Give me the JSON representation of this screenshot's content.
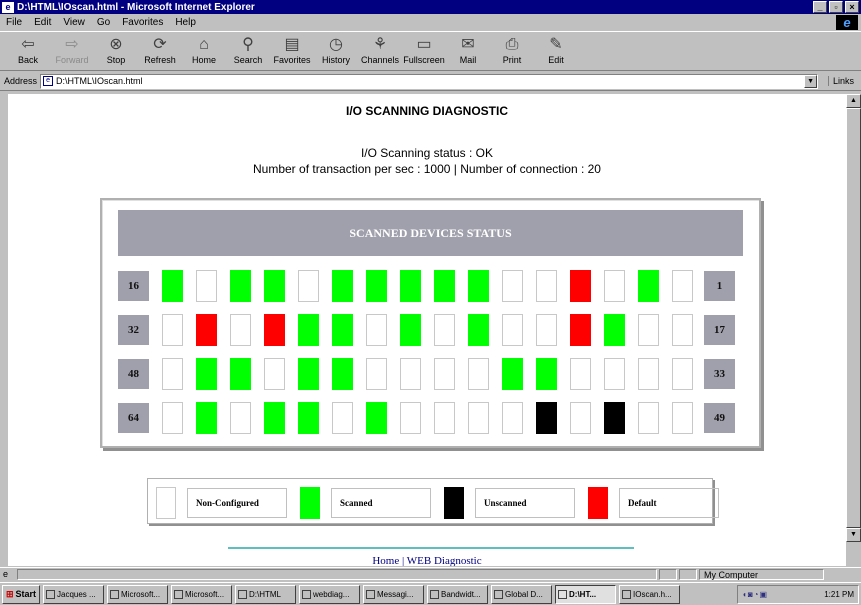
{
  "window": {
    "title": "D:\\HTML\\IOscan.html - Microsoft Internet Explorer",
    "controls": [
      "_",
      "▫",
      "×"
    ]
  },
  "menu": [
    "File",
    "Edit",
    "View",
    "Go",
    "Favorites",
    "Help"
  ],
  "toolbar": [
    {
      "label": "Back",
      "icon": "back-arrow-icon",
      "glyph": "⇦",
      "enabled": true
    },
    {
      "label": "Forward",
      "icon": "forward-arrow-icon",
      "glyph": "⇨",
      "enabled": false
    },
    {
      "label": "Stop",
      "icon": "stop-icon",
      "glyph": "⊗",
      "enabled": true
    },
    {
      "label": "Refresh",
      "icon": "refresh-icon",
      "glyph": "⟳",
      "enabled": true
    },
    {
      "label": "Home",
      "icon": "home-icon",
      "glyph": "⌂",
      "enabled": true
    },
    {
      "label": "Search",
      "icon": "search-icon",
      "glyph": "⚲",
      "enabled": true
    },
    {
      "label": "Favorites",
      "icon": "favorites-icon",
      "glyph": "▤",
      "enabled": true
    },
    {
      "label": "History",
      "icon": "history-icon",
      "glyph": "◷",
      "enabled": true
    },
    {
      "label": "Channels",
      "icon": "channels-icon",
      "glyph": "⚘",
      "enabled": true
    },
    {
      "label": "Fullscreen",
      "icon": "fullscreen-icon",
      "glyph": "▭",
      "enabled": true
    },
    {
      "label": "Mail",
      "icon": "mail-icon",
      "glyph": "✉",
      "enabled": true
    },
    {
      "label": "Print",
      "icon": "print-icon",
      "glyph": "⎙",
      "enabled": true
    },
    {
      "label": "Edit",
      "icon": "edit-icon",
      "glyph": "✎",
      "enabled": true
    }
  ],
  "address": {
    "label": "Address",
    "value": "D:\\HTML\\IOscan.html",
    "links": "Links"
  },
  "page": {
    "title": "I/O SCANNING DIAGNOSTIC",
    "status_line": "I/O Scanning status : OK",
    "stats_line": "Number of transaction per sec : 1000 | Number of connection : 20",
    "panel_title": "SCANNED DEVICES STATUS",
    "colors": {
      "scanned": "#00ff00",
      "default": "#ff0000",
      "unscanned": "#000000",
      "non_configured": "#ffffff",
      "header_gray": "#a0a0ac"
    },
    "rows": [
      {
        "left": "16",
        "right": "1",
        "cells": [
          "scanned",
          "non_configured",
          "scanned",
          "scanned",
          "non_configured",
          "scanned",
          "scanned",
          "scanned",
          "scanned",
          "scanned",
          "non_configured",
          "non_configured",
          "default",
          "non_configured",
          "scanned",
          "non_configured"
        ]
      },
      {
        "left": "32",
        "right": "17",
        "cells": [
          "non_configured",
          "default",
          "non_configured",
          "default",
          "scanned",
          "scanned",
          "non_configured",
          "scanned",
          "non_configured",
          "scanned",
          "non_configured",
          "non_configured",
          "default",
          "scanned",
          "non_configured",
          "non_configured"
        ]
      },
      {
        "left": "48",
        "right": "33",
        "cells": [
          "non_configured",
          "scanned",
          "scanned",
          "non_configured",
          "scanned",
          "scanned",
          "non_configured",
          "non_configured",
          "non_configured",
          "non_configured",
          "scanned",
          "scanned",
          "non_configured",
          "non_configured",
          "non_configured",
          "non_configured"
        ]
      },
      {
        "left": "64",
        "right": "49",
        "cells": [
          "non_configured",
          "scanned",
          "non_configured",
          "scanned",
          "scanned",
          "non_configured",
          "scanned",
          "non_configured",
          "non_configured",
          "non_configured",
          "non_configured",
          "unscanned",
          "non_configured",
          "unscanned",
          "non_configured",
          "non_configured"
        ]
      }
    ],
    "legend": [
      {
        "key": "non_configured",
        "label": "Non-Configured"
      },
      {
        "key": "scanned",
        "label": "Scanned"
      },
      {
        "key": "unscanned",
        "label": "Unscanned"
      },
      {
        "key": "default",
        "label": "Default"
      }
    ],
    "footer": {
      "home": "Home",
      "separator": " | ",
      "web_diag": "WEB Diagnostic"
    }
  },
  "statusbar": {
    "zone": "My Computer"
  },
  "taskbar": {
    "start": "Start",
    "tasks": [
      {
        "label": "Jacques ...",
        "active": false
      },
      {
        "label": "Microsoft...",
        "active": false
      },
      {
        "label": "Microsoft...",
        "active": false
      },
      {
        "label": "D:\\HTML",
        "active": false
      },
      {
        "label": "webdiag...",
        "active": false
      },
      {
        "label": "Messagi...",
        "active": false
      },
      {
        "label": "Bandwidt...",
        "active": false
      },
      {
        "label": "Global D...",
        "active": false
      },
      {
        "label": "D:\\HT...",
        "active": true
      },
      {
        "label": "IOscan.h...",
        "active": false
      }
    ],
    "clock": "1:21 PM"
  }
}
